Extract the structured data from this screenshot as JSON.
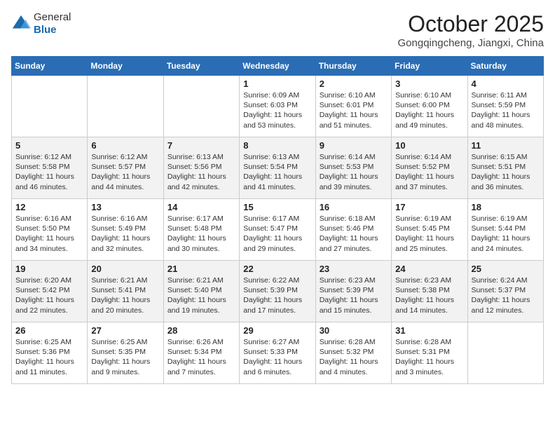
{
  "header": {
    "logo_line1": "General",
    "logo_line2": "Blue",
    "month": "October 2025",
    "location": "Gongqingcheng, Jiangxi, China"
  },
  "weekdays": [
    "Sunday",
    "Monday",
    "Tuesday",
    "Wednesday",
    "Thursday",
    "Friday",
    "Saturday"
  ],
  "weeks": [
    [
      {
        "day": "",
        "info": ""
      },
      {
        "day": "",
        "info": ""
      },
      {
        "day": "",
        "info": ""
      },
      {
        "day": "1",
        "info": "Sunrise: 6:09 AM\nSunset: 6:03 PM\nDaylight: 11 hours\nand 53 minutes."
      },
      {
        "day": "2",
        "info": "Sunrise: 6:10 AM\nSunset: 6:01 PM\nDaylight: 11 hours\nand 51 minutes."
      },
      {
        "day": "3",
        "info": "Sunrise: 6:10 AM\nSunset: 6:00 PM\nDaylight: 11 hours\nand 49 minutes."
      },
      {
        "day": "4",
        "info": "Sunrise: 6:11 AM\nSunset: 5:59 PM\nDaylight: 11 hours\nand 48 minutes."
      }
    ],
    [
      {
        "day": "5",
        "info": "Sunrise: 6:12 AM\nSunset: 5:58 PM\nDaylight: 11 hours\nand 46 minutes."
      },
      {
        "day": "6",
        "info": "Sunrise: 6:12 AM\nSunset: 5:57 PM\nDaylight: 11 hours\nand 44 minutes."
      },
      {
        "day": "7",
        "info": "Sunrise: 6:13 AM\nSunset: 5:56 PM\nDaylight: 11 hours\nand 42 minutes."
      },
      {
        "day": "8",
        "info": "Sunrise: 6:13 AM\nSunset: 5:54 PM\nDaylight: 11 hours\nand 41 minutes."
      },
      {
        "day": "9",
        "info": "Sunrise: 6:14 AM\nSunset: 5:53 PM\nDaylight: 11 hours\nand 39 minutes."
      },
      {
        "day": "10",
        "info": "Sunrise: 6:14 AM\nSunset: 5:52 PM\nDaylight: 11 hours\nand 37 minutes."
      },
      {
        "day": "11",
        "info": "Sunrise: 6:15 AM\nSunset: 5:51 PM\nDaylight: 11 hours\nand 36 minutes."
      }
    ],
    [
      {
        "day": "12",
        "info": "Sunrise: 6:16 AM\nSunset: 5:50 PM\nDaylight: 11 hours\nand 34 minutes."
      },
      {
        "day": "13",
        "info": "Sunrise: 6:16 AM\nSunset: 5:49 PM\nDaylight: 11 hours\nand 32 minutes."
      },
      {
        "day": "14",
        "info": "Sunrise: 6:17 AM\nSunset: 5:48 PM\nDaylight: 11 hours\nand 30 minutes."
      },
      {
        "day": "15",
        "info": "Sunrise: 6:17 AM\nSunset: 5:47 PM\nDaylight: 11 hours\nand 29 minutes."
      },
      {
        "day": "16",
        "info": "Sunrise: 6:18 AM\nSunset: 5:46 PM\nDaylight: 11 hours\nand 27 minutes."
      },
      {
        "day": "17",
        "info": "Sunrise: 6:19 AM\nSunset: 5:45 PM\nDaylight: 11 hours\nand 25 minutes."
      },
      {
        "day": "18",
        "info": "Sunrise: 6:19 AM\nSunset: 5:44 PM\nDaylight: 11 hours\nand 24 minutes."
      }
    ],
    [
      {
        "day": "19",
        "info": "Sunrise: 6:20 AM\nSunset: 5:42 PM\nDaylight: 11 hours\nand 22 minutes."
      },
      {
        "day": "20",
        "info": "Sunrise: 6:21 AM\nSunset: 5:41 PM\nDaylight: 11 hours\nand 20 minutes."
      },
      {
        "day": "21",
        "info": "Sunrise: 6:21 AM\nSunset: 5:40 PM\nDaylight: 11 hours\nand 19 minutes."
      },
      {
        "day": "22",
        "info": "Sunrise: 6:22 AM\nSunset: 5:39 PM\nDaylight: 11 hours\nand 17 minutes."
      },
      {
        "day": "23",
        "info": "Sunrise: 6:23 AM\nSunset: 5:39 PM\nDaylight: 11 hours\nand 15 minutes."
      },
      {
        "day": "24",
        "info": "Sunrise: 6:23 AM\nSunset: 5:38 PM\nDaylight: 11 hours\nand 14 minutes."
      },
      {
        "day": "25",
        "info": "Sunrise: 6:24 AM\nSunset: 5:37 PM\nDaylight: 11 hours\nand 12 minutes."
      }
    ],
    [
      {
        "day": "26",
        "info": "Sunrise: 6:25 AM\nSunset: 5:36 PM\nDaylight: 11 hours\nand 11 minutes."
      },
      {
        "day": "27",
        "info": "Sunrise: 6:25 AM\nSunset: 5:35 PM\nDaylight: 11 hours\nand 9 minutes."
      },
      {
        "day": "28",
        "info": "Sunrise: 6:26 AM\nSunset: 5:34 PM\nDaylight: 11 hours\nand 7 minutes."
      },
      {
        "day": "29",
        "info": "Sunrise: 6:27 AM\nSunset: 5:33 PM\nDaylight: 11 hours\nand 6 minutes."
      },
      {
        "day": "30",
        "info": "Sunrise: 6:28 AM\nSunset: 5:32 PM\nDaylight: 11 hours\nand 4 minutes."
      },
      {
        "day": "31",
        "info": "Sunrise: 6:28 AM\nSunset: 5:31 PM\nDaylight: 11 hours\nand 3 minutes."
      },
      {
        "day": "",
        "info": ""
      }
    ]
  ]
}
